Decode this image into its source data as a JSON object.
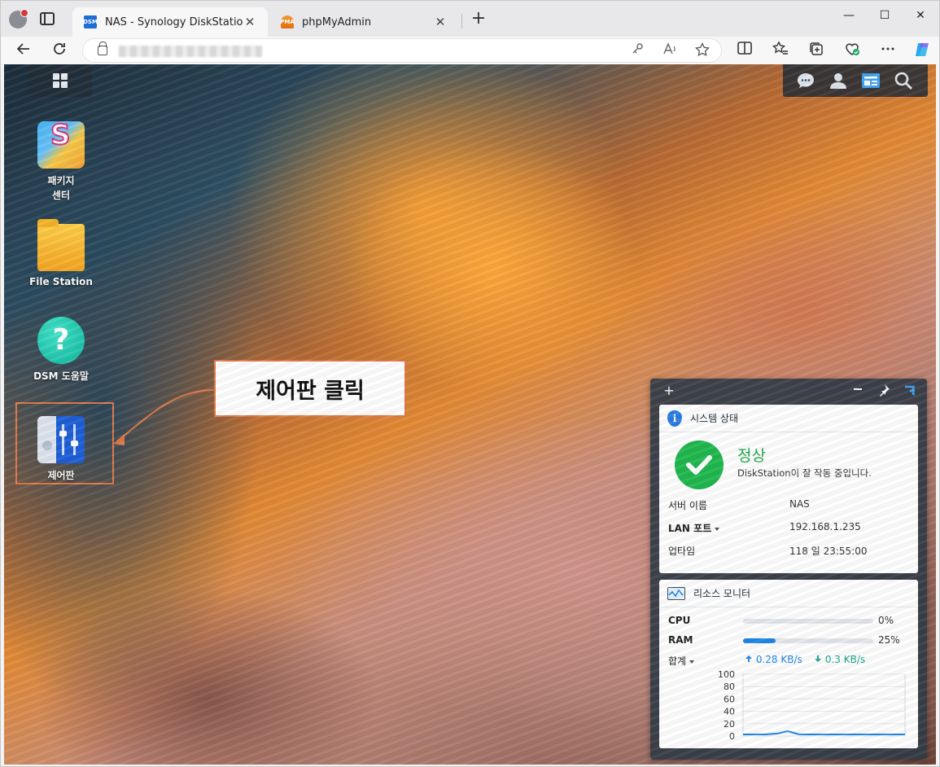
{
  "browser": {
    "tabs": [
      {
        "label": "NAS - Synology DiskStation",
        "favicon": "DSM",
        "active": true
      },
      {
        "label": "phpMyAdmin",
        "favicon": "PMA",
        "active": false
      }
    ],
    "close_glyph": "✕",
    "new_tab_glyph": "+",
    "window_controls": {
      "minimize": "—",
      "maximize": "☐",
      "close": "✕"
    }
  },
  "desktop": {
    "icons": [
      {
        "label": "패키지\n센터",
        "icon": "package-center-icon"
      },
      {
        "label": "File Station",
        "icon": "folder-icon"
      },
      {
        "label": "DSM 도움말",
        "icon": "help-icon"
      },
      {
        "label": "제어판",
        "icon": "control-panel-icon"
      }
    ],
    "callout": "제어판 클릭"
  },
  "widget": {
    "system_status": {
      "title": "시스템 상태",
      "status": "정상",
      "description": "DiskStation이 잘 작동 중입니다.",
      "rows": [
        {
          "key": "서버 이름",
          "value": "NAS"
        },
        {
          "key": "LAN 포트",
          "value": "192.168.1.235"
        },
        {
          "key": "업타임",
          "value": "118 일 23:55:00"
        }
      ]
    },
    "resource_monitor": {
      "title": "리소스 모니터",
      "cpu_label": "CPU",
      "cpu_percent": 0,
      "cpu_text": "0%",
      "ram_label": "RAM",
      "ram_percent": 25,
      "ram_text": "25%",
      "total_label": "합계",
      "upload": "0.28 KB/s",
      "download": "0.3 KB/s",
      "chart_ticks": [
        "100",
        "80",
        "60",
        "40",
        "20",
        "0"
      ]
    }
  },
  "colors": {
    "accent": "#1e88e5",
    "ok": "#21b84f",
    "highlight": "#e07a4a"
  }
}
